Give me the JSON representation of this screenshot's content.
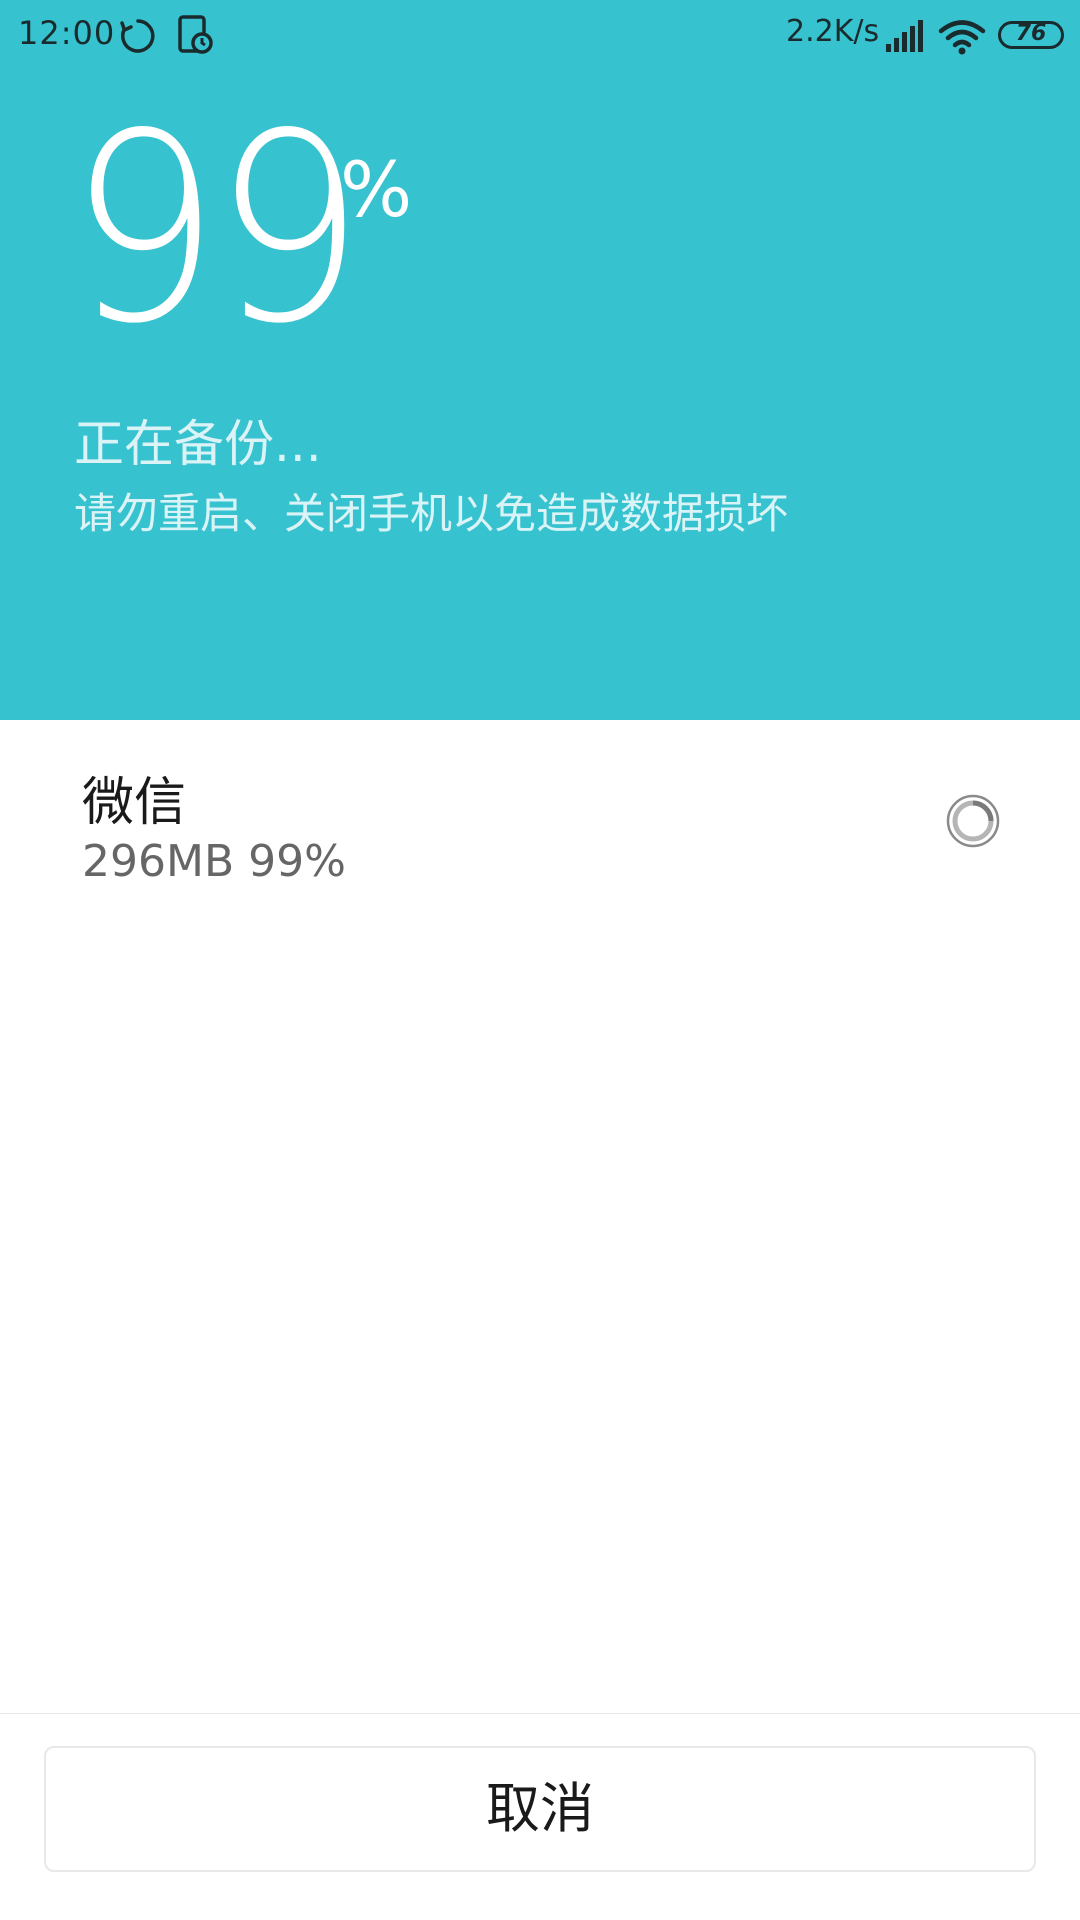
{
  "status_bar": {
    "time": "12:00",
    "net_speed": "2.2K/s",
    "battery": "76",
    "battery_level": 0.76,
    "icons": [
      "sync-icon",
      "backup-icon",
      "signal-icon",
      "wifi-icon",
      "battery-icon"
    ]
  },
  "progress": {
    "number": "99",
    "percent_sign": "%",
    "value": 0.99,
    "title": "正在备份...",
    "warning": "请勿重启、关闭手机以免造成数据损坏"
  },
  "items": [
    {
      "name": "微信",
      "detail": "296MB 99%",
      "status_icon": "spinner-icon"
    }
  ],
  "cancel_label": "取消",
  "colors": {
    "header_bg": "#37c2cf",
    "header_text": "#d9f3f6",
    "white": "#ffffff"
  }
}
